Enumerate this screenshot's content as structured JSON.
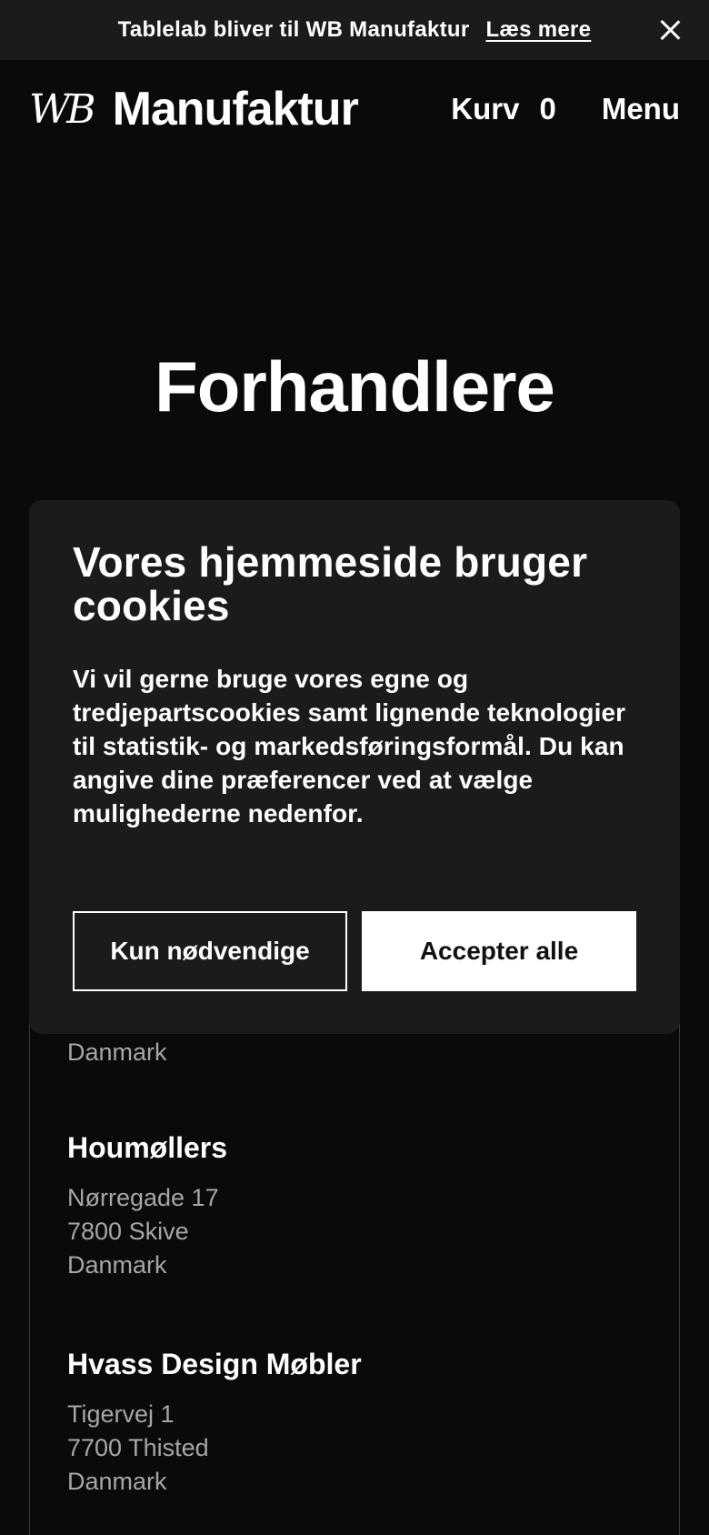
{
  "announcement": {
    "text": "Tablelab bliver til WB Manufaktur",
    "link": "Læs mere"
  },
  "header": {
    "logo_mark": "WB",
    "logo_text": "Manufaktur",
    "cart_label": "Kurv",
    "cart_count": "0",
    "menu_label": "Menu"
  },
  "page": {
    "title": "Forhandlere"
  },
  "cookie": {
    "title": "Vores hjemmeside bruger cookies",
    "body": "Vi vil gerne bruge vores egne og tredjepartscookies samt lignende teknologier til statistik- og markedsføringsformål. Du kan angive dine præferencer ved at vælge mulighederne nedenfor.",
    "necessary_label": "Kun nødvendige",
    "accept_label": "Accepter alle"
  },
  "dealers": {
    "partial_country": "Danmark",
    "items": [
      {
        "name": "Houmøllers",
        "street": "Nørregade 17",
        "city": "7800 Skive",
        "country": "Danmark"
      },
      {
        "name": "Hvass Design Møbler",
        "street": "Tigervej 1",
        "city": "7700 Thisted",
        "country": "Danmark"
      }
    ]
  }
}
